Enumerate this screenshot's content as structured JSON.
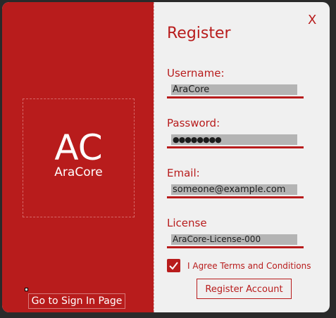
{
  "logo": {
    "mark": "AC",
    "name": "AraCore"
  },
  "left": {
    "goto_signin_label": "Go to Sign In Page"
  },
  "form": {
    "close_label": "X",
    "title": "Register",
    "fields": [
      {
        "label": "Username:",
        "value": "AraCore"
      },
      {
        "label": "Password:",
        "value": "●●●●●●●●"
      },
      {
        "label": "Email:",
        "value": "someone@example.com"
      },
      {
        "label": "License",
        "value": "AraCore-License-000"
      }
    ],
    "agree_label": "I Agree Terms and Conditions",
    "agree_checked": true,
    "register_label": "Register Account"
  },
  "colors": {
    "accent": "#b81c1c",
    "panel": "#f0f0f0",
    "field": "#b4b4b4"
  },
  "icons": {
    "checkbox": "checkmark-icon"
  }
}
